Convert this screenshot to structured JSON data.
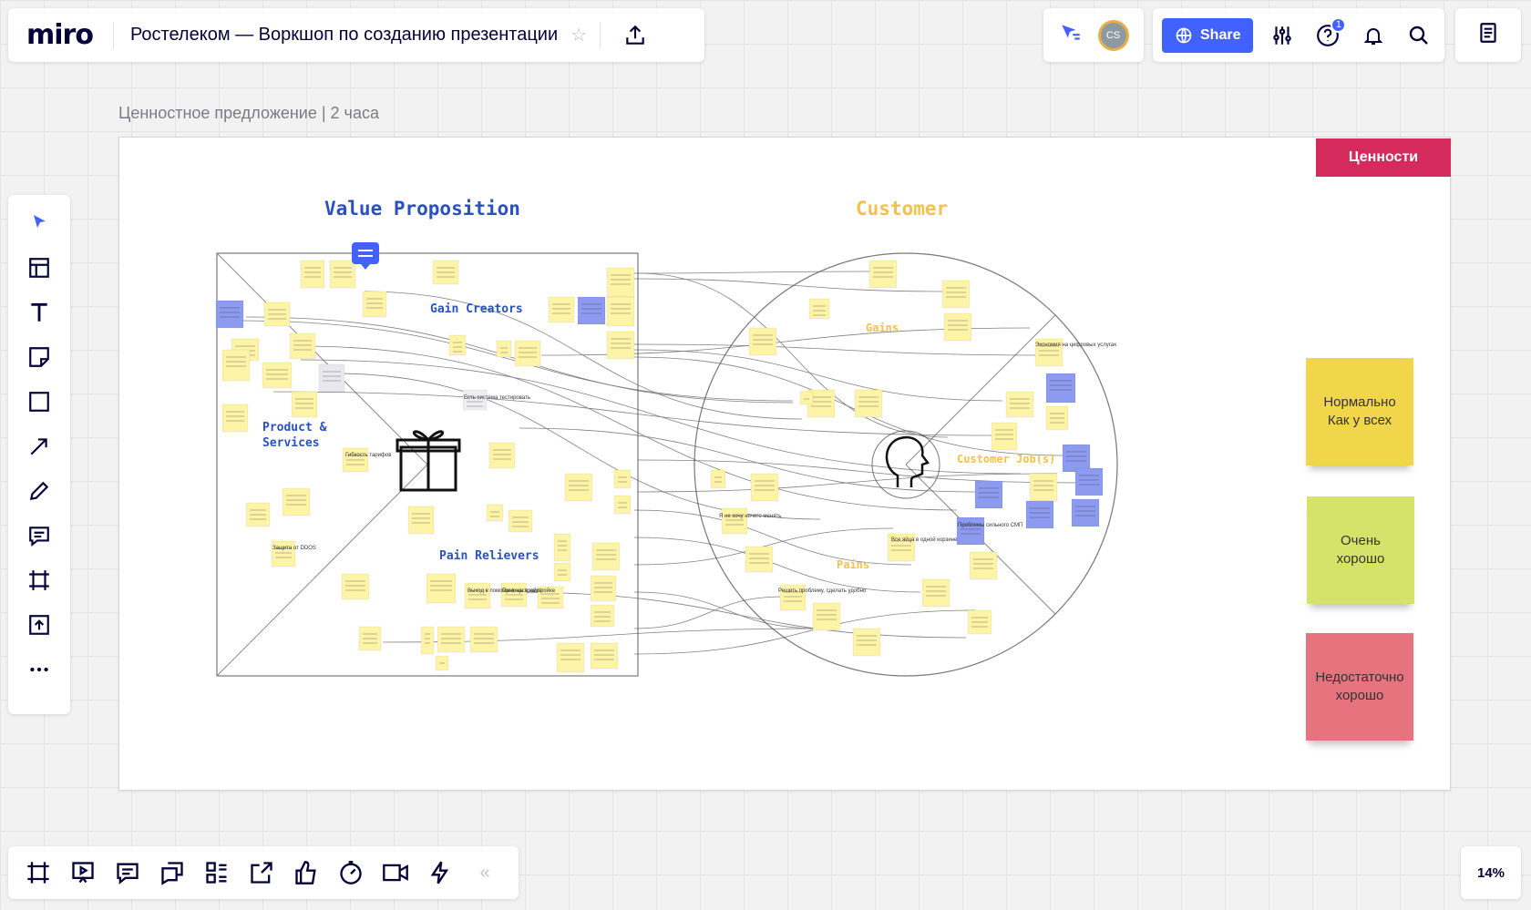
{
  "app": {
    "logo": "miro"
  },
  "board": {
    "title": "Ростелеком — Воркшоп по созданию презентации"
  },
  "header": {
    "share_label": "Share",
    "avatar_initials": "CS",
    "help_badge": "1"
  },
  "frame": {
    "title": "Ценностное предложение | 2 часа",
    "tag": "Ценности",
    "value_proposition": "Value Proposition",
    "customer": "Customer",
    "gain_creators": "Gain Creators",
    "product_services_1": "Product &",
    "product_services_2": "Services",
    "pain_relievers": "Pain Relievers",
    "gains": "Gains",
    "customer_jobs": "Customer Job(s)",
    "pains": "Pains"
  },
  "legend": {
    "normal_1": "Нормально",
    "normal_2": "Как у всех",
    "good_1": "Очень",
    "good_2": "хорошо",
    "bad_1": "Недостаточно",
    "bad_2": "хорошо"
  },
  "stickies_readable": {
    "s1": "Гибкость тарифов",
    "s2": "Защита от DDOS",
    "s3": "Выход в помощь в настройке",
    "s4": "Помощь в настройке",
    "s5": "Все яйца в одной корзине",
    "s6": "Я не хочу ничего менять",
    "s7": "Решить проблему, сделать удобно",
    "s8": "Экономия на цифровых услугах",
    "s9": "Проблемы сильного СМП",
    "s10": "Есть система тестировать"
  },
  "zoom": {
    "level": "14%"
  },
  "colors": {
    "accent": "#4262ff",
    "tag": "#d42b5c",
    "value_title": "#2a52be",
    "customer_title": "#f2c14e",
    "sticky_yellow": "#fdf4a8",
    "sticky_blue": "#8c9bf0"
  },
  "icons": {
    "left_toolbar": [
      "cursor-icon",
      "templates-icon",
      "text-icon",
      "sticky-note-icon",
      "shape-icon",
      "arrow-icon",
      "pen-icon",
      "comment-icon",
      "frame-icon",
      "upload-icon",
      "more-icon"
    ],
    "bottom_toolbar": [
      "frames-icon",
      "presentation-icon",
      "comments-icon",
      "screen-share-icon",
      "cards-icon",
      "export-icon",
      "voting-icon",
      "timer-icon",
      "video-icon",
      "activity-icon",
      "collapse-icon"
    ]
  }
}
